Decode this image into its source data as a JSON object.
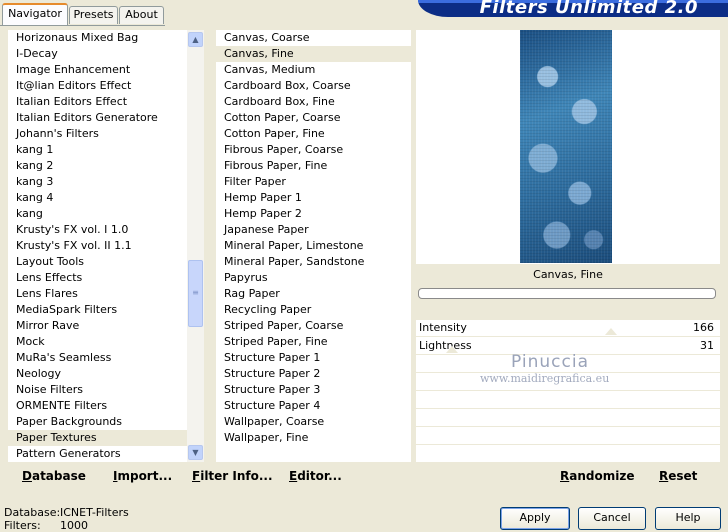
{
  "title": "Filters Unlimited 2.0",
  "tabs": [
    {
      "label": "Navigator",
      "active": true
    },
    {
      "label": "Presets",
      "active": false
    },
    {
      "label": "About",
      "active": false
    }
  ],
  "categories": [
    "Horizonaus Mixed Bag",
    "I-Decay",
    "Image Enhancement",
    "It@lian Editors Effect",
    "Italian Editors Effect",
    "Italian Editors Generatore",
    "Johann's Filters",
    "kang 1",
    "kang 2",
    "kang 3",
    "kang 4",
    "kang",
    "Krusty's FX vol. I 1.0",
    "Krusty's FX vol. II 1.1",
    "Layout Tools",
    "Lens Effects",
    "Lens Flares",
    "MediaSpark Filters",
    "Mirror Rave",
    "Mock",
    "MuRa's Seamless",
    "Neology",
    "Noise Filters",
    "ORMENTE Filters",
    "Paper Backgrounds",
    "Paper Textures",
    "Pattern Generators"
  ],
  "selected_category": "Paper Textures",
  "filters": [
    "Canvas, Coarse",
    "Canvas, Fine",
    "Canvas, Medium",
    "Cardboard Box, Coarse",
    "Cardboard Box, Fine",
    "Cotton Paper, Coarse",
    "Cotton Paper, Fine",
    "Fibrous Paper, Coarse",
    "Fibrous Paper, Fine",
    "Filter Paper",
    "Hemp Paper 1",
    "Hemp Paper 2",
    "Japanese Paper",
    "Mineral Paper, Limestone",
    "Mineral Paper, Sandstone",
    "Papyrus",
    "Rag Paper",
    "Recycling Paper",
    "Striped Paper, Coarse",
    "Striped Paper, Fine",
    "Structure Paper 1",
    "Structure Paper 2",
    "Structure Paper 3",
    "Structure Paper 4",
    "Wallpaper, Coarse",
    "Wallpaper, Fine"
  ],
  "selected_filter": "Canvas, Fine",
  "preview": {
    "filter_name": "Canvas, Fine",
    "params": [
      {
        "label": "Intensity",
        "value": "166",
        "level": 0.65
      },
      {
        "label": "Lightness",
        "value": "31",
        "level": 0.12
      }
    ],
    "watermark_name": "Pinuccia",
    "watermark_url": "www.maidiregrafica.eu"
  },
  "left_buttons": {
    "database": "Database",
    "import": "Import...",
    "filter_info": "Filter Info...",
    "editor": "Editor..."
  },
  "right_buttons": {
    "randomize": "Randomize",
    "reset": "Reset"
  },
  "status": {
    "database_label": "Database:",
    "database_value": "ICNET-Filters",
    "filters_label": "Filters:",
    "filters_value": "1000"
  },
  "dialog_buttons": {
    "apply": "Apply",
    "cancel": "Cancel",
    "help": "Help"
  },
  "icons": {
    "scroll_up": "triangle-up-icon",
    "scroll_down": "triangle-down-icon",
    "scroll_grip": "grip-icon"
  }
}
